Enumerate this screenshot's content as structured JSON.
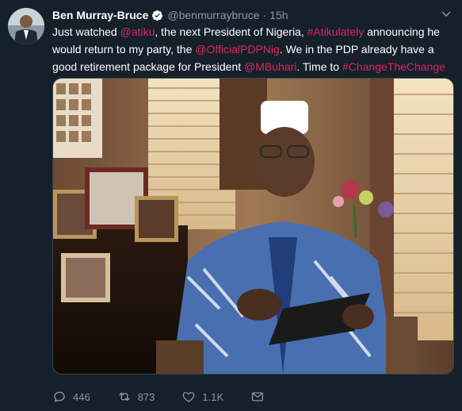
{
  "tweet": {
    "author_name": "Ben Murray-Bruce",
    "handle": "@benmurraybruce",
    "separator": "·",
    "time": "15h",
    "text_parts": {
      "p1": "Just watched ",
      "m1": "@atiku",
      "p2": ", the next President of Nigeria, ",
      "h1": "#Atikulately",
      "p3": " announcing he would return to my party, the ",
      "m2": "@OfficialPDPNig",
      "p4": ". We in the PDP already have a good retirement package for President ",
      "m3": "@MBuhari",
      "p5": ". Time to ",
      "h2": "#ChangeTheChange"
    },
    "icons": {
      "verified": "verified-badge-icon",
      "caret": "chevron-down-icon",
      "reply": "reply-icon",
      "retweet": "retweet-icon",
      "like": "heart-icon",
      "dm": "envelope-icon"
    },
    "actions": {
      "reply_count": "446",
      "retweet_count": "873",
      "like_count": "1.1K"
    },
    "colors": {
      "background": "#15202b",
      "link": "#e0245e",
      "muted": "#8899a6",
      "verified": "#ffffff"
    }
  }
}
